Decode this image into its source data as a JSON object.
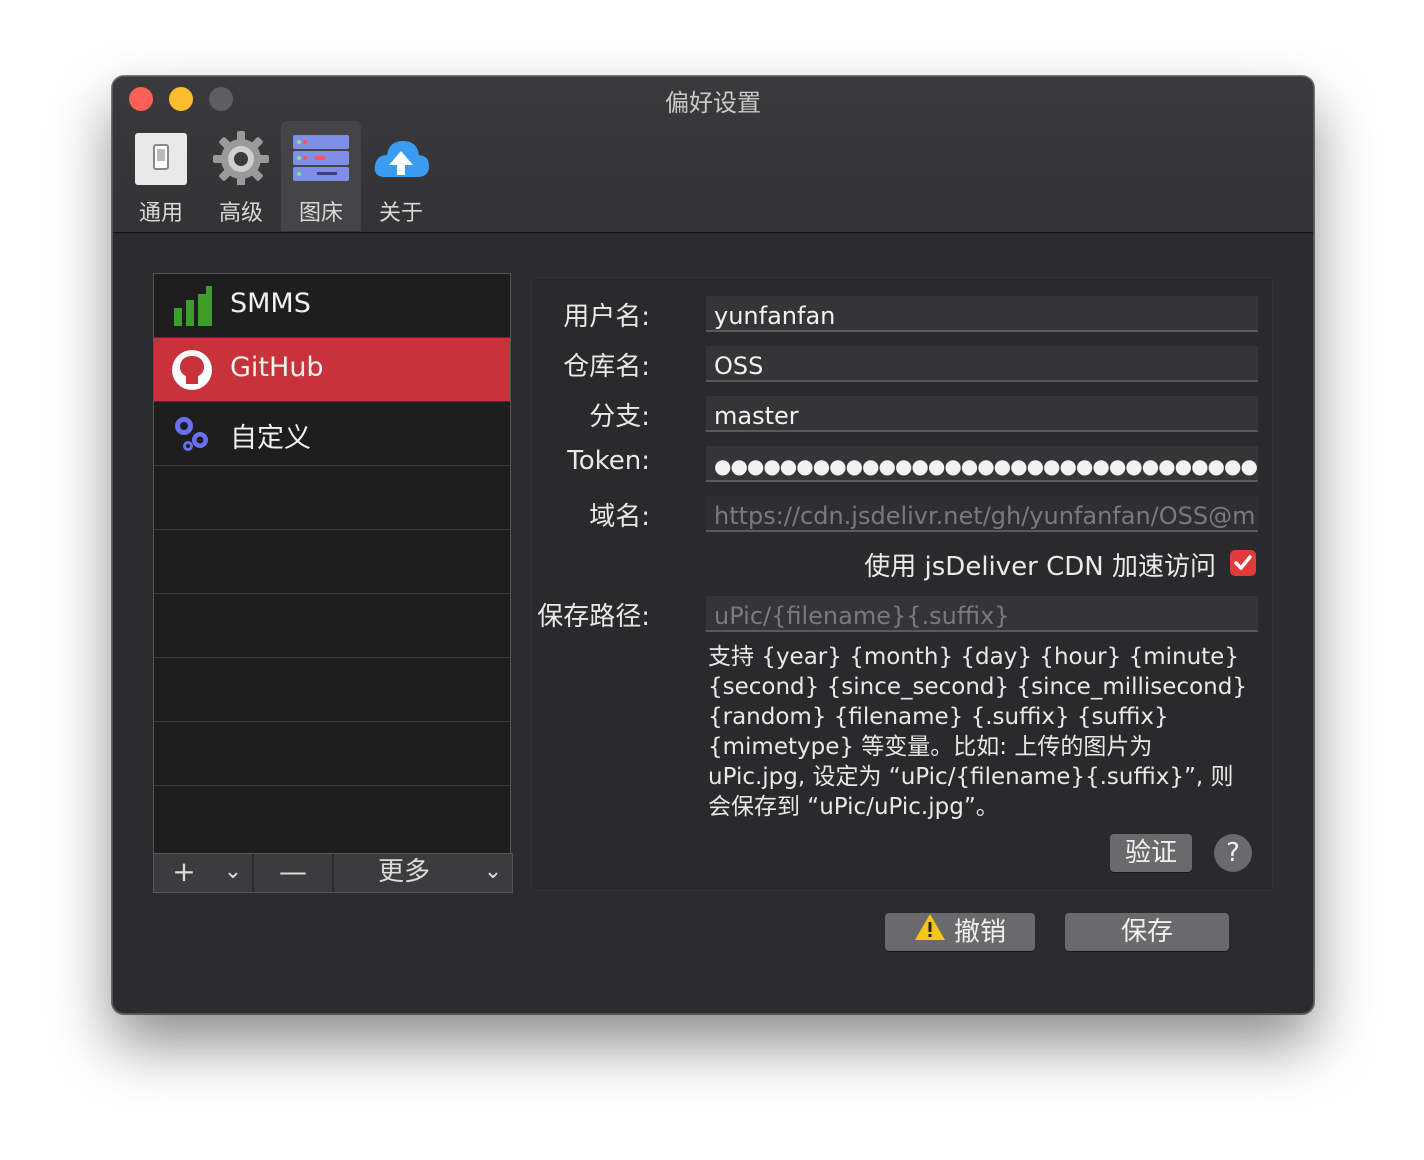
{
  "window": {
    "title": "偏好设置"
  },
  "toolbar": [
    {
      "label": "通用",
      "icon": "switch-icon"
    },
    {
      "label": "高级",
      "icon": "gear-icon"
    },
    {
      "label": "图床",
      "icon": "server-icon",
      "active": true
    },
    {
      "label": "关于",
      "icon": "cloud-upload-icon"
    }
  ],
  "hosts": [
    {
      "label": "SMMS",
      "icon": "signal-bars-icon"
    },
    {
      "label": "GitHub",
      "icon": "github-icon",
      "selected": true
    },
    {
      "label": "自定义",
      "icon": "gears-icon"
    }
  ],
  "list_footer": {
    "add": "+",
    "add_menu": "⌄",
    "remove": "—",
    "more": "更多",
    "more_menu": "⌄"
  },
  "form": {
    "username_label": "用户名:",
    "username_value": "yunfanfan",
    "repo_label": "仓库名:",
    "repo_value": "OSS",
    "branch_label": "分支:",
    "branch_value": "master",
    "token_label": "Token:",
    "token_value": "●●●●●●●●●●●●●●●●●●●●●●●●●●●●●●●●●●…",
    "domain_label": "域名:",
    "domain_value": "https://cdn.jsdelivr.net/gh/yunfanfan/OSS@m…",
    "cdn_label": "使用 jsDeliver CDN 加速访问",
    "cdn_checked": true,
    "path_label": "保存路径:",
    "path_placeholder": "uPic/{filename}{.suffix}",
    "help_text": "支持 {year} {month} {day} {hour} {minute} {second} {since_second} {since_millisecond} {random} {filename} {.suffix} {suffix} {mimetype} 等变量。比如: 上传的图片为 uPic.jpg, 设定为 “uPic/{filename}{.suffix}”, 则会保存到 “uPic/uPic.jpg”。",
    "verify_button": "验证",
    "help_button": "?"
  },
  "actions": {
    "cancel": "撤销",
    "save": "保存"
  },
  "colors": {
    "selected_row": "#c8323a",
    "checkbox": "#e23b3b",
    "window_bg": "#2c2c2e"
  }
}
